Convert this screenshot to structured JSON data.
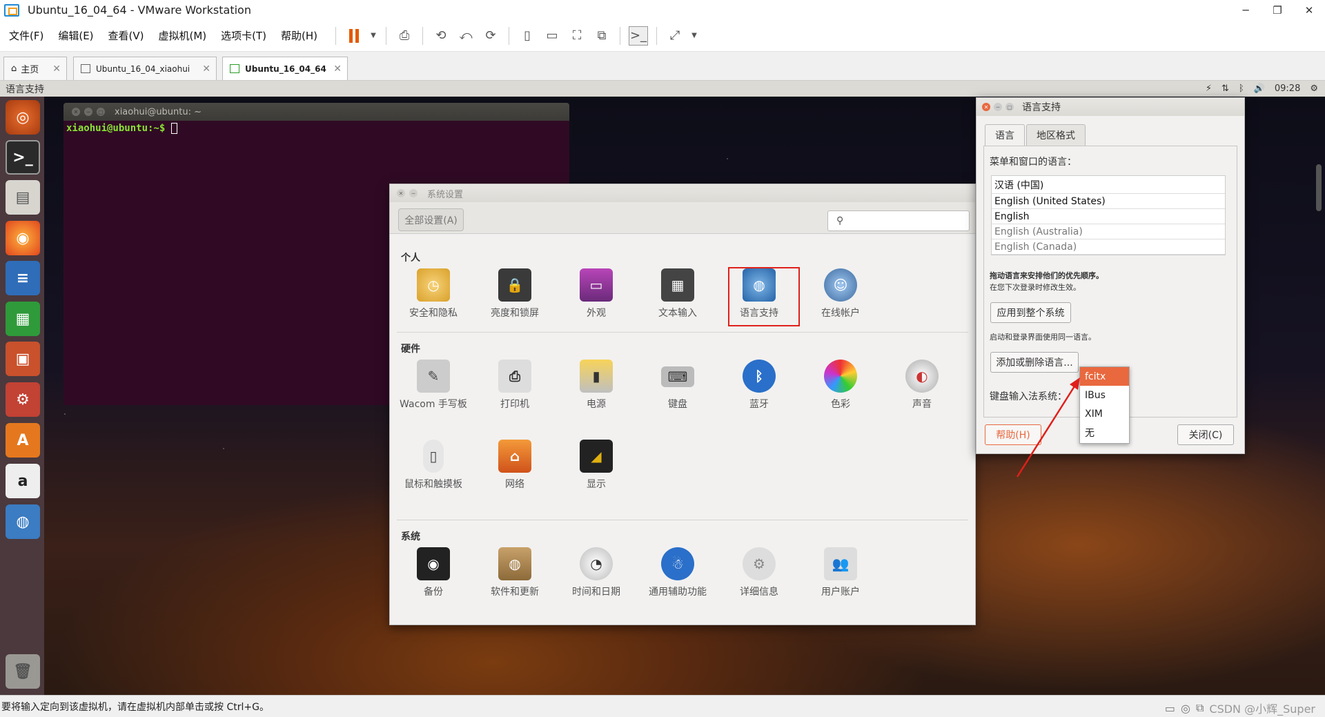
{
  "window": {
    "title": "Ubuntu_16_04_64 - VMware Workstation",
    "controls": [
      "─",
      "❐",
      "✕"
    ]
  },
  "menu": [
    "文件(F)",
    "编辑(E)",
    "查看(V)",
    "虚拟机(M)",
    "选项卡(T)",
    "帮助(H)"
  ],
  "tabs": [
    {
      "label": "主页"
    },
    {
      "label": "Ubuntu_16_04_xiaohui"
    },
    {
      "label": "Ubuntu_16_04_64"
    }
  ],
  "ubuntu": {
    "app_name": "语言支持",
    "time": "09:28"
  },
  "terminal": {
    "title": "xiaohui@ubuntu: ~",
    "prompt": "xiaohui@ubuntu:~$"
  },
  "settings": {
    "title": "系统设置",
    "all_button": "全部设置(A)",
    "search_placeholder": "",
    "sections": {
      "personal": "个人",
      "hardware": "硬件",
      "system": "系统"
    },
    "personal": [
      "安全和隐私",
      "亮度和锁屏",
      "外观",
      "文本输入",
      "语言支持",
      "在线帐户"
    ],
    "hardware": [
      "Wacom 手写板",
      "打印机",
      "电源",
      "键盘",
      "蓝牙",
      "色彩",
      "声音",
      "鼠标和触摸板",
      "网络",
      "显示"
    ],
    "system": [
      "备份",
      "软件和更新",
      "时间和日期",
      "通用辅助功能",
      "详细信息",
      "用户账户"
    ]
  },
  "language": {
    "title": "语言支持",
    "tabs": [
      "语言",
      "地区格式"
    ],
    "menu_lang_label": "菜单和窗口的语言：",
    "languages": [
      "汉语 (中国)",
      "English (United States)",
      "English",
      "English (Australia)",
      "English (Canada)"
    ],
    "drag_hint": "拖动语言来安排他们的优先顺序。",
    "drag_hint2": "在您下次登录时修改生效。",
    "apply_button": "应用到整个系统",
    "login_hint": "启动和登录界面使用同一语言。",
    "add_remove_button": "添加或删除语言...",
    "input_method_label": "键盘输入法系统：",
    "help_button": "帮助(H)",
    "close_button": "关闭(C)",
    "input_methods": [
      "fcitx",
      "IBus",
      "XIM",
      "无"
    ]
  },
  "statusbar": {
    "text": "要将输入定向到该虚拟机，请在虚拟机内部单击或按 Ctrl+G。",
    "watermark": "CSDN @小辉_Super"
  },
  "colors": {
    "accent": "#e9683e",
    "highlight": "#e0201a",
    "terminal_bg": "#300a24"
  }
}
